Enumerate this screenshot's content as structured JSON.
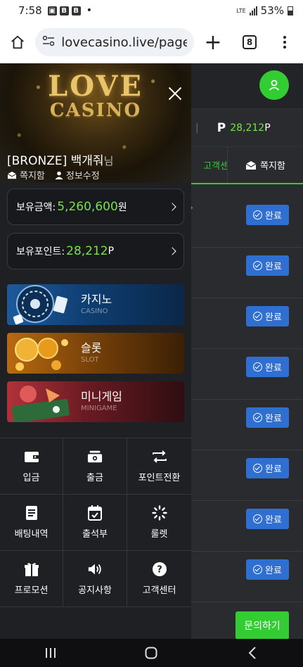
{
  "status_bar": {
    "time": "7:58",
    "network": "LTE",
    "battery": "53%"
  },
  "browser": {
    "url": "lovecasino.live/page?h",
    "tab_count": "8"
  },
  "background_page": {
    "points_label": "P",
    "points_value": "28,212",
    "points_unit": "P",
    "tab_support": "고객센터",
    "tab_messages": "쪽지함",
    "status_label": "완료",
    "rows_count": 8,
    "inquiry_button": "문의하기"
  },
  "drawer": {
    "logo_line1": "LOVE",
    "logo_line2": "CASINO",
    "user_name": "[BRONZE] 백개줘",
    "user_suffix": "님",
    "link_messages": "쪽지함",
    "link_edit": "정보수정",
    "balance_label": "보유금액:",
    "balance_value": "5,260,600",
    "balance_unit": "원",
    "points_label": "보유포인트:",
    "points_value": "28,212",
    "points_unit": "P",
    "games": [
      {
        "ko": "카지노",
        "en": "CASINO"
      },
      {
        "ko": "슬롯",
        "en": "SLOT"
      },
      {
        "ko": "미니게임",
        "en": "MINIGAME"
      }
    ],
    "menu": [
      {
        "label": "입금",
        "icon": "wallet-icon"
      },
      {
        "label": "출금",
        "icon": "cash-icon"
      },
      {
        "label": "포인트전환",
        "icon": "exchange-icon"
      },
      {
        "label": "배팅내역",
        "icon": "document-icon"
      },
      {
        "label": "출석부",
        "icon": "calendar-check-icon"
      },
      {
        "label": "룰렛",
        "icon": "spinner-icon"
      },
      {
        "label": "프로모션",
        "icon": "gift-icon"
      },
      {
        "label": "공지사항",
        "icon": "speaker-icon"
      },
      {
        "label": "고객센터",
        "icon": "question-icon"
      }
    ]
  }
}
